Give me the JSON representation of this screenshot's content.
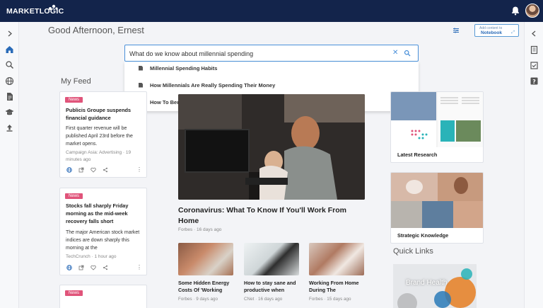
{
  "app": {
    "logo_text": "MARKETLOGIC"
  },
  "header": {
    "greeting": "Good Afternoon, Ernest"
  },
  "notebook_button": {
    "small_label": "Add content to",
    "label": "Notebook"
  },
  "search": {
    "value": "What do we know about millennial spending",
    "suggestions": [
      "Millennial Spending Habits",
      "How Millennials Are Really Spending Their Money",
      "How To Benefit From Millennial Spending Habits"
    ]
  },
  "feed": {
    "title": "My Feed",
    "cards": [
      {
        "badge": "News",
        "title": "Publicis Groupe suspends financial guidance",
        "body": "First quarter revenue will be published April 23rd before the market opens.",
        "source": "Campaign Asia: Advertising · 19 minutes ago"
      },
      {
        "badge": "News",
        "title": "Stocks fall sharply Friday morning as the mid-week recovery falls short",
        "body": "The major American stock market indices are down sharply this morning at the",
        "source": "TechCrunch · 1 hour ago"
      },
      {
        "badge": "News"
      }
    ]
  },
  "main_article": {
    "title": "Coronavirus: What To Know If You'll Work From Home",
    "source": "Forbes · 16 days ago"
  },
  "small_articles": [
    {
      "title": "Some Hidden Energy Costs Of 'Working",
      "source": "Forbes · 9 days ago"
    },
    {
      "title": "How to stay sane and productive when",
      "source": "CNet · 16 days ago"
    },
    {
      "title": "Working From Home During The",
      "source": "Forbes · 15 days ago"
    }
  ],
  "right_column": {
    "latest_research": "Latest Research",
    "strategic_knowledge": "Strategic Knowledge",
    "quick_links_title": "Quick Links",
    "brand_health": "Brand Health"
  },
  "colors": {
    "topbar": "#13244b",
    "accent": "#4a90d9",
    "badge": "#e0547a"
  }
}
